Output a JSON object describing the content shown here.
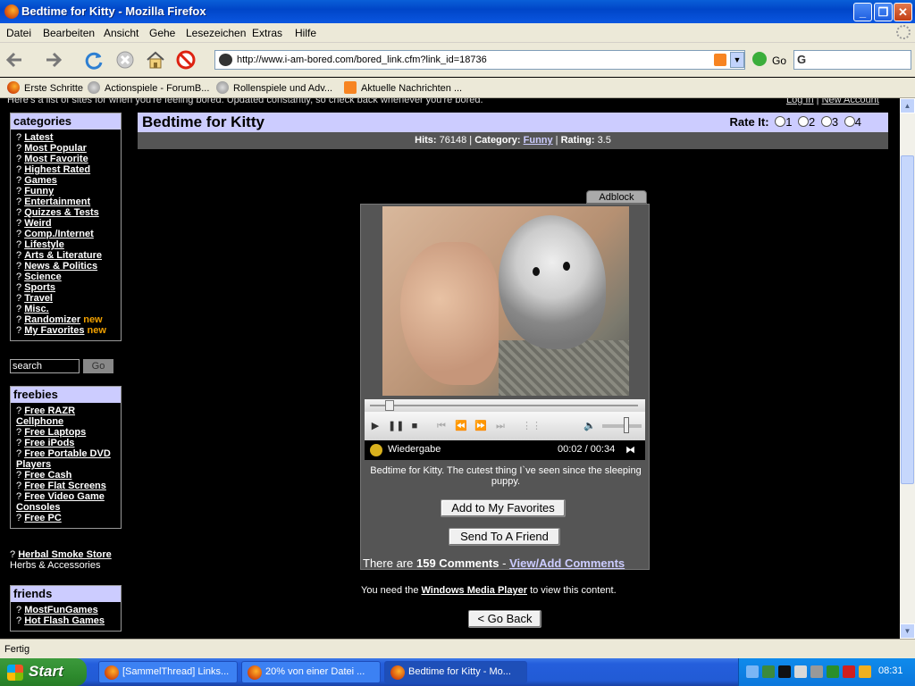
{
  "window": {
    "title": "Bedtime for Kitty - Mozilla Firefox",
    "buttons": [
      "_",
      "❐",
      "✕"
    ]
  },
  "menu": [
    "Datei",
    "Bearbeiten",
    "Ansicht",
    "Gehe",
    "Lesezeichen",
    "Extras",
    "Hilfe"
  ],
  "toolbar": {
    "url": "http://www.i-am-bored.com/bored_link.cfm?link_id=18736",
    "go_label": "Go",
    "search_glyph": "G"
  },
  "bookmarks": [
    {
      "label": "Erste Schritte",
      "icon": "firefox-icon"
    },
    {
      "label": "Actionspiele - ForumB...",
      "icon": "globe-icon"
    },
    {
      "label": "Rollenspiele und Adv...",
      "icon": "globe-icon"
    },
    {
      "label": "Aktuelle Nachrichten ...",
      "icon": "rss-icon"
    }
  ],
  "page": {
    "tagline": "Here's a list of sites for when you're feeling bored. Updated constantly, so check back whenever you're bored.",
    "login": "Log In",
    "separator": "|",
    "new_account": "New Account",
    "title": "Bedtime for Kitty",
    "rate_label": "Rate It:",
    "rate_options": [
      "1",
      "2",
      "3",
      "4"
    ],
    "stats": {
      "hits_label": "Hits:",
      "hits": "76148",
      "category_label": "Category:",
      "category": "Funny",
      "rating_label": "Rating:",
      "rating": "3.5"
    },
    "adblock": "Adblock",
    "player": {
      "status": "Wiedergabe",
      "time": "00:02 / 00:34",
      "progress": 0.06,
      "volume": 0.6
    },
    "description": "Bedtime for Kitty. The cutest thing I`ve seen since the sleeping puppy.",
    "add_favorites": "Add to My Favorites",
    "send_friend": "Send To A Friend",
    "comments_prefix": "There are",
    "comments_count": "159 Comments",
    "comments_sep": "-",
    "comments_link": "View/Add Comments",
    "wmp_prefix": "You need the",
    "wmp_link": "Windows Media Player",
    "wmp_suffix": "to view this content.",
    "go_back": "< Go Back"
  },
  "sidebar": {
    "categories_title": "categories",
    "categories": [
      {
        "label": "Latest"
      },
      {
        "label": "Most Popular"
      },
      {
        "label": "Most Favorite"
      },
      {
        "label": "Highest Rated"
      },
      {
        "label": "Games"
      },
      {
        "label": "Funny"
      },
      {
        "label": "Entertainment"
      },
      {
        "label": "Quizzes & Tests"
      },
      {
        "label": "Weird"
      },
      {
        "label": "Comp./Internet"
      },
      {
        "label": "Lifestyle"
      },
      {
        "label": "Arts & Literature"
      },
      {
        "label": "News & Politics"
      },
      {
        "label": "Science"
      },
      {
        "label": "Sports"
      },
      {
        "label": "Travel"
      },
      {
        "label": "Misc."
      },
      {
        "label": "Randomizer",
        "tag": "new"
      },
      {
        "label": "My Favorites",
        "tag": "new"
      }
    ],
    "bullet": "?",
    "search_value": "search",
    "search_go": "Go",
    "freebies_title": "freebies",
    "freebies": [
      "Free RAZR Cellphone",
      "Free Laptops",
      "Free iPods",
      "Free Portable DVD Players",
      "Free Cash",
      "Free Flat Screens",
      "Free Video Game Consoles",
      "Free PC"
    ],
    "herbal_link": "Herbal Smoke Store",
    "herbal_sub": "Herbs & Accessories",
    "friends_title": "friends",
    "friends": [
      "MostFunGames",
      "Hot Flash Games"
    ]
  },
  "statusbar": "Fertig",
  "taskbar": {
    "start": "Start",
    "tasks": [
      {
        "label": "[SammelThread] Links...",
        "active": false
      },
      {
        "label": "20% von einer Datei ...",
        "active": false
      },
      {
        "label": "Bedtime for Kitty - Mo...",
        "active": true
      }
    ],
    "clock": "08:31"
  }
}
